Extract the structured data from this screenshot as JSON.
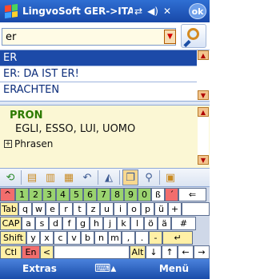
{
  "titlebar": {
    "title": "LingvoSoft GER->ITA",
    "icons": [
      "sync-icon",
      "speaker-icon",
      "close-icon"
    ],
    "ok_label": "ok"
  },
  "search": {
    "value": "er",
    "dropdown_icon": "chevron-down-icon",
    "button_icon": "magnifier-icon"
  },
  "wordlist": {
    "items": [
      "ER",
      "ER: DA IST ER!",
      "ERACHTEN"
    ],
    "selected_index": 0
  },
  "translation": {
    "part_of_speech": "PRON",
    "meaning": "EGLI, ESSO, LUI, UOMO",
    "expander": "⊞",
    "phrases_label": "Phrasen"
  },
  "toolbar": {
    "icons": [
      "refresh-icon",
      "copy-icon",
      "paste-icon",
      "note-icon",
      "undo-icon",
      "speak-icon",
      "translate-icon",
      "find-icon",
      "book-icon"
    ]
  },
  "keyboard": {
    "row1": [
      "^",
      "1",
      "2",
      "3",
      "4",
      "5",
      "6",
      "7",
      "8",
      "9",
      "0",
      "ß",
      "´",
      "⇐"
    ],
    "row2": [
      "Tab",
      "q",
      "w",
      "e",
      "r",
      "t",
      "z",
      "u",
      "i",
      "o",
      "p",
      "ü",
      "+"
    ],
    "row3": [
      "CAP",
      "a",
      "s",
      "d",
      "f",
      "g",
      "h",
      "j",
      "k",
      "l",
      "ö",
      "ä",
      "#"
    ],
    "row4": [
      "Shift",
      "y",
      "x",
      "c",
      "v",
      "b",
      "n",
      "m",
      ",",
      ".",
      "-",
      "↵"
    ],
    "row5": [
      "Ctl",
      "En",
      "<",
      "",
      "Alt",
      "↓",
      "↑",
      "←",
      "→"
    ]
  },
  "bottombar": {
    "left_label": "Extras",
    "right_label": "Menü",
    "keyboard_icon": "keyboard-icon"
  },
  "colors": {
    "titlebar": "#1848a8",
    "selection": "#1c4aa8",
    "translation_bg": "#fbf7d4",
    "pos_text": "#2c7a00",
    "key_green": "#9ad36f",
    "key_yellow": "#fff0a6",
    "key_red": "#f26d6d"
  }
}
